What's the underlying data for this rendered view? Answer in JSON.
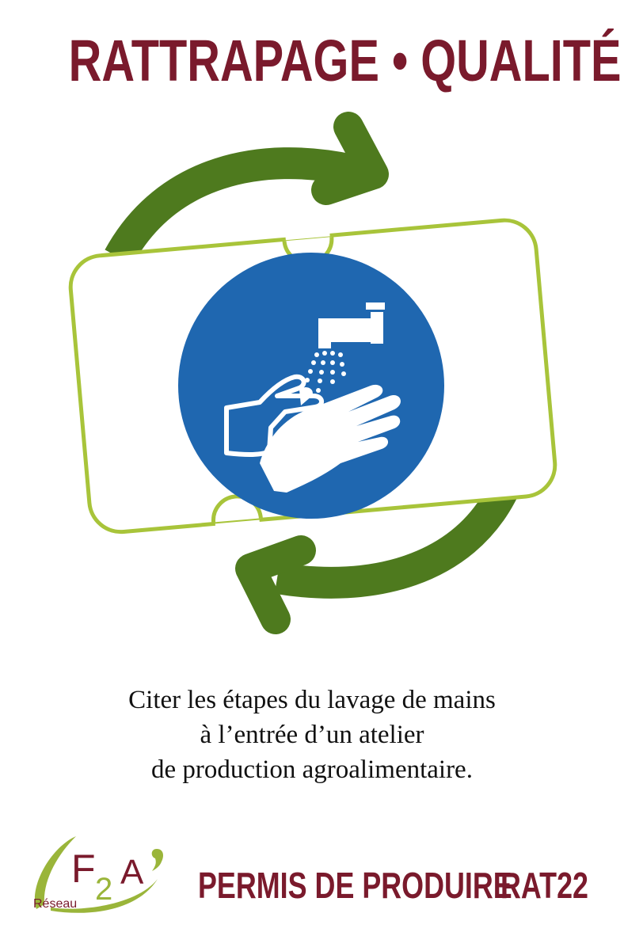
{
  "header": {
    "title": "RATTRAPAGE • QUALITÉ"
  },
  "illustration": {
    "icon": "handwashing-icon",
    "cycle_arrows_icon": "cycle-arrows-icon",
    "colors": {
      "arrow_green": "#4e7a1e",
      "frame_green": "#a8c43a",
      "circle_blue": "#1f67b0"
    }
  },
  "instruction": {
    "lines": [
      "Citer les étapes du lavage de mains",
      "à l’entrée d’un atelier",
      "de production agroalimentaire."
    ]
  },
  "footer": {
    "logo": {
      "big_text": "F",
      "small_text": "2",
      "accent_text": "A",
      "caption": "Réseau"
    },
    "label": "PERMIS DE PRODUIRE",
    "code": "RAT22"
  },
  "colors": {
    "brand": "#7a1a2c",
    "text": "#111111"
  }
}
